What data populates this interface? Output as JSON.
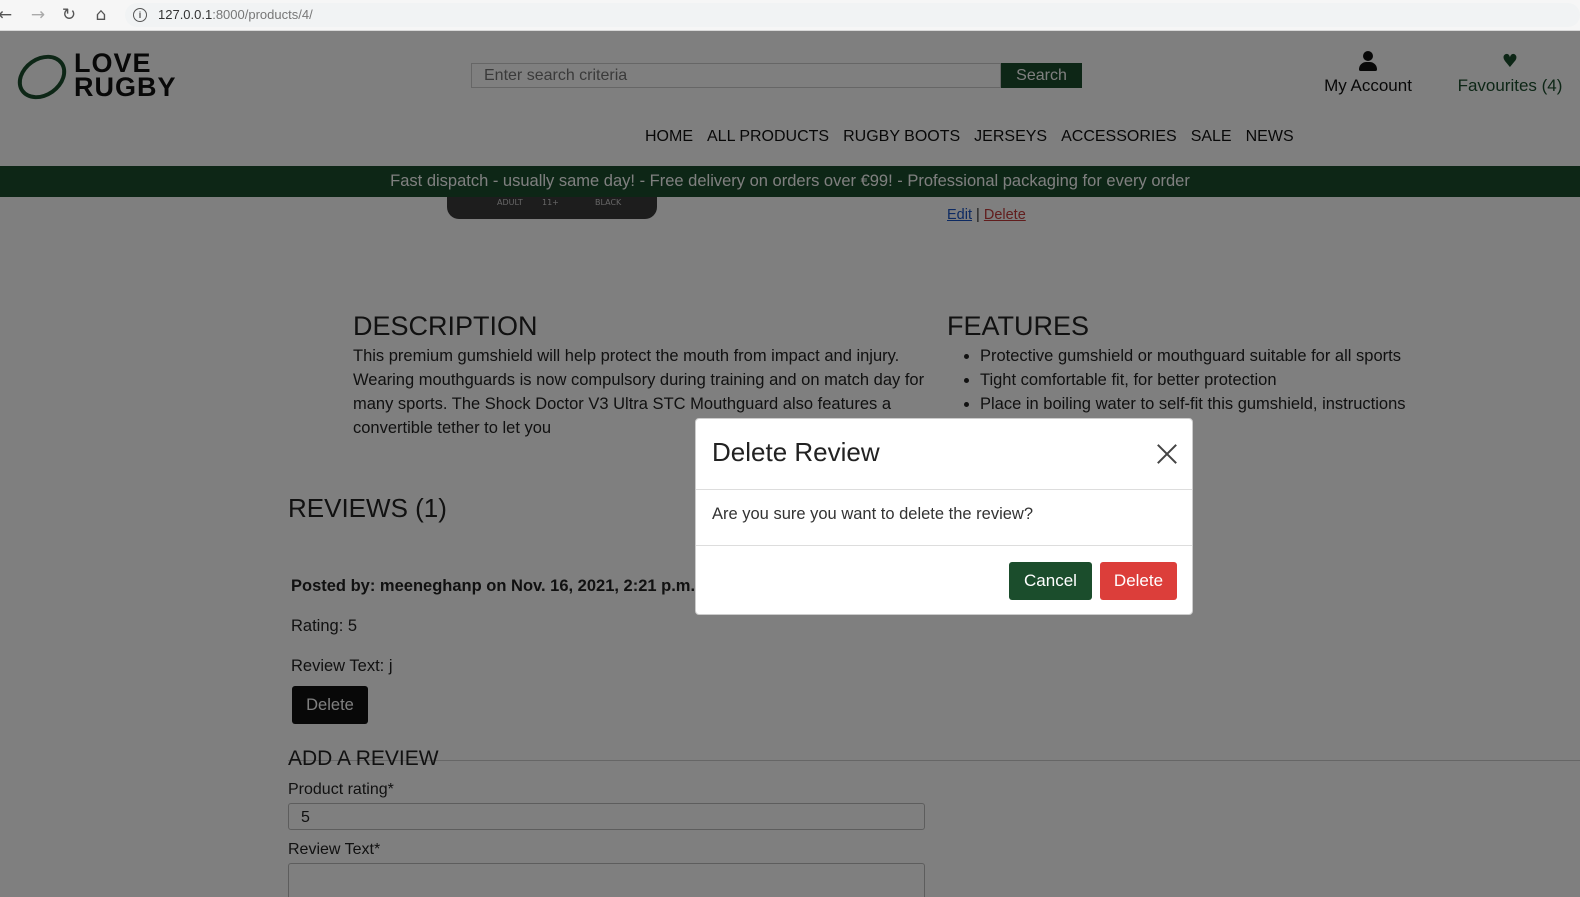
{
  "browser": {
    "url_host": "127.0.0.1",
    "url_rest": ":8000/products/4/"
  },
  "header": {
    "logo_line1": "LOVE",
    "logo_line2": "RUGBY",
    "search_placeholder": "Enter search criteria",
    "search_button": "Search",
    "account_label": "My Account",
    "favourites_label": "Favourites (4)"
  },
  "nav": {
    "items": [
      "HOME",
      "ALL PRODUCTS",
      "RUGBY BOOTS",
      "JERSEYS",
      "ACCESSORIES",
      "SALE",
      "NEWS"
    ]
  },
  "banner": {
    "text": "Fast dispatch - usually same day! - Free delivery on orders over €99! - Professional packaging for every order"
  },
  "product": {
    "image_text_left": "ADULT",
    "image_text_mid": "11+",
    "image_text_right": "BLACK",
    "edit_label": "Edit",
    "separator": "|",
    "delete_label": "Delete"
  },
  "description": {
    "heading": "DESCRIPTION",
    "text": "This premium gumshield will help protect the mouth from impact and injury. Wearing mouthguards is now compulsory during training and on match day for many sports. The Shock Doctor V3 Ultra STC Mouthguard also features a convertible tether to let you"
  },
  "features": {
    "heading": "FEATURES",
    "items": [
      "Protective gumshield or mouthguard suitable for all sports",
      "Tight comfortable fit, for better protection",
      "Place in boiling water to self-fit this gumshield, instructions"
    ]
  },
  "reviews": {
    "heading": "REVIEWS (1)",
    "posted_by": "Posted by: meeneghanp on Nov. 16, 2021, 2:21 p.m.",
    "rating": "Rating: 5",
    "review_text": "Review Text: j",
    "delete_button": "Delete"
  },
  "add_review": {
    "heading": "ADD A REVIEW",
    "rating_label": "Product rating*",
    "rating_value": "5",
    "text_label": "Review Text*"
  },
  "modal": {
    "title": "Delete Review",
    "body": "Are you sure you want to delete the review?",
    "cancel": "Cancel",
    "delete": "Delete"
  },
  "colors": {
    "brand_green": "#1b4d2c",
    "danger_red": "#dc3e3a",
    "overlay": "rgba(0,0,0,0.5)"
  }
}
